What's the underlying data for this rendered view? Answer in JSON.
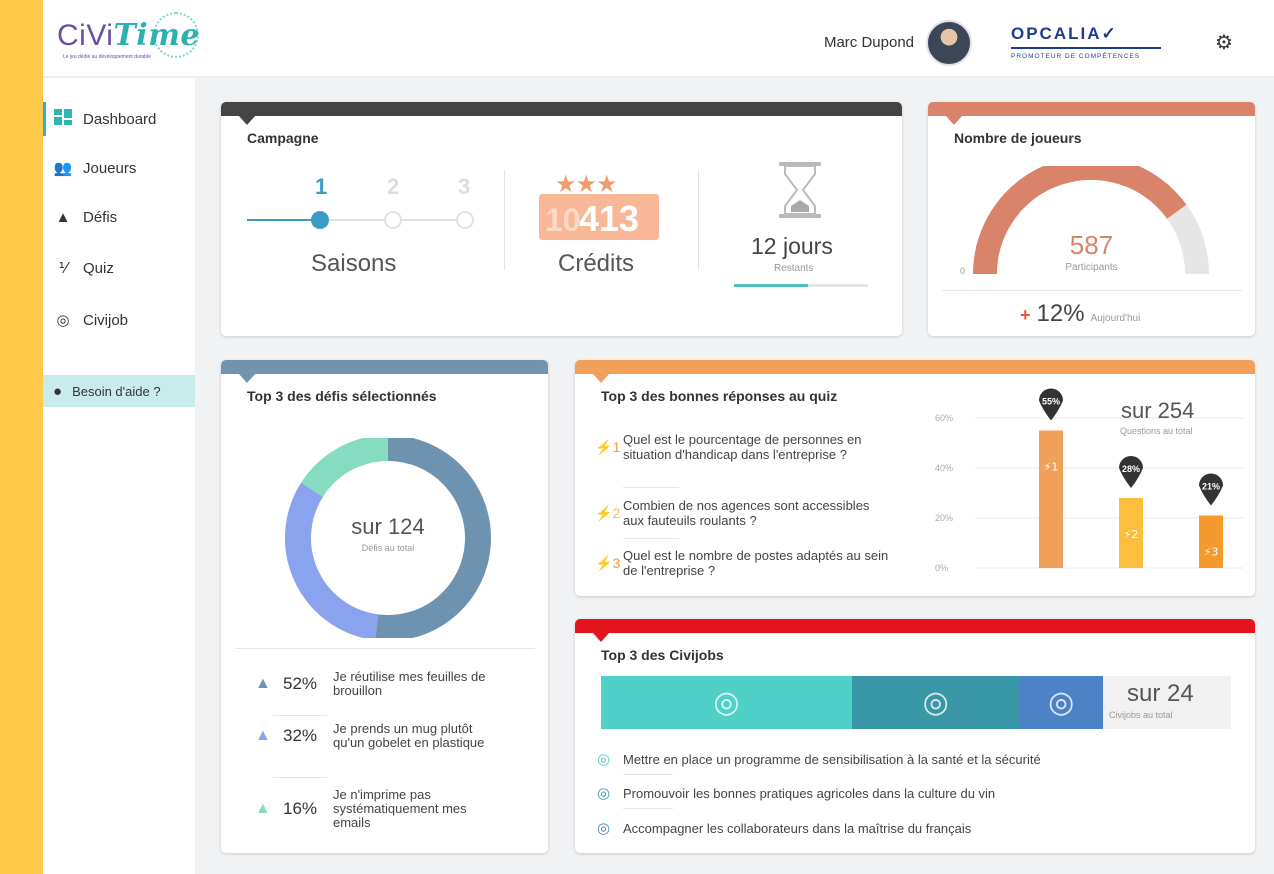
{
  "header": {
    "logo": {
      "name": "CiViTime",
      "brand_a": "CiVi",
      "brand_b": "Time",
      "tagline": "Le jeu dédié au développement durable"
    },
    "user_name": "Marc Dupond",
    "partner": {
      "title": "OPCALIA",
      "subtitle": "PROMOTEUR DE COMPÉTENCES"
    },
    "settings_icon": "gear-icon"
  },
  "sidebar": {
    "items": [
      {
        "label": "Dashboard",
        "icon": "dashboard-icon",
        "active": true
      },
      {
        "label": "Joueurs",
        "icon": "players-icon"
      },
      {
        "label": "Défis",
        "icon": "mountain-flag-icon"
      },
      {
        "label": "Quiz",
        "icon": "quiz-icon"
      },
      {
        "label": "Civijob",
        "icon": "target-icon"
      }
    ],
    "help_label": "Besoin d'aide ?"
  },
  "campaign": {
    "title": "Campagne",
    "seasons": {
      "steps": [
        "1",
        "2",
        "3"
      ],
      "current": 1,
      "label": "Saisons"
    },
    "credits": {
      "value": "413",
      "ghost": "10",
      "label": "Crédits"
    },
    "remaining": {
      "value": "12 jours",
      "label": "Restants",
      "progress": 0.55
    }
  },
  "players": {
    "title": "Nombre de joueurs",
    "gauge_min": "0",
    "value": "587",
    "label": "Participants",
    "fraction": 0.8,
    "delta": "12%",
    "delta_sign": "+",
    "delta_label": "Aujourd'hui"
  },
  "defis": {
    "title": "Top 3 des défis sélectionnés",
    "center_value": "sur 124",
    "center_label": "Défis au total",
    "items": [
      {
        "pct": "52%",
        "value": 52,
        "label": "Je réutilise mes feuilles de brouillon",
        "color": "#6e93b0"
      },
      {
        "pct": "32%",
        "value": 32,
        "label": "Je prends un mug plutôt qu'un gobelet en plastique",
        "color": "#8aa3ef"
      },
      {
        "pct": "16%",
        "value": 16,
        "label": "Je n'imprime pas systématiquement mes emails",
        "color": "#86dcc0"
      }
    ]
  },
  "quiz": {
    "title": "Top 3 des bonnes réponses au quiz",
    "total_value": "sur 254",
    "total_label": "Questions au total",
    "questions": [
      {
        "num": "1",
        "text": "Quel est le pourcentage de personnes en  situation d'handicap dans l'entreprise ?"
      },
      {
        "num": "2",
        "text": "Combien de nos agences sont accessibles aux fauteuils roulants ?"
      },
      {
        "num": "3",
        "text": "Quel est le nombre de postes adaptés au sein de l'entreprise ?"
      }
    ],
    "chart_data": {
      "type": "bar",
      "categories": [
        "1",
        "2",
        "3"
      ],
      "values": [
        55,
        28,
        21
      ],
      "data_labels": [
        "55%",
        "28%",
        "21%"
      ],
      "colors": [
        "#f0a05a",
        "#fbbf3d",
        "#f79a2e"
      ],
      "yticks": [
        "0%",
        "20%",
        "40%",
        "60%"
      ],
      "ylim": [
        0,
        60
      ],
      "grid": true,
      "xlabel": "",
      "ylabel": ""
    }
  },
  "civijobs": {
    "title": "Top 3 des Civijobs",
    "total_value": "sur 24",
    "total_label": "Civijobs au total",
    "segments": [
      {
        "value": 48,
        "color": "#4fd0c8"
      },
      {
        "value": 32,
        "color": "#3a97a8"
      },
      {
        "value": 16,
        "color": "#4d83c6"
      }
    ],
    "items": [
      "Mettre en place un programme de sensibilisation à la santé et la sécurité",
      "Promouvoir les bonnes pratiques agricoles dans la culture du vin",
      "Accompagner les collaborateurs dans la maîtrise du français"
    ]
  },
  "colors": {
    "accent": "#2cb8b0",
    "campaign_bar": "#444444",
    "players_bar": "#d9836b",
    "defis_bar": "#7394ae",
    "quiz_bar": "#f0a05a",
    "civijobs_bar": "#e3141b"
  }
}
